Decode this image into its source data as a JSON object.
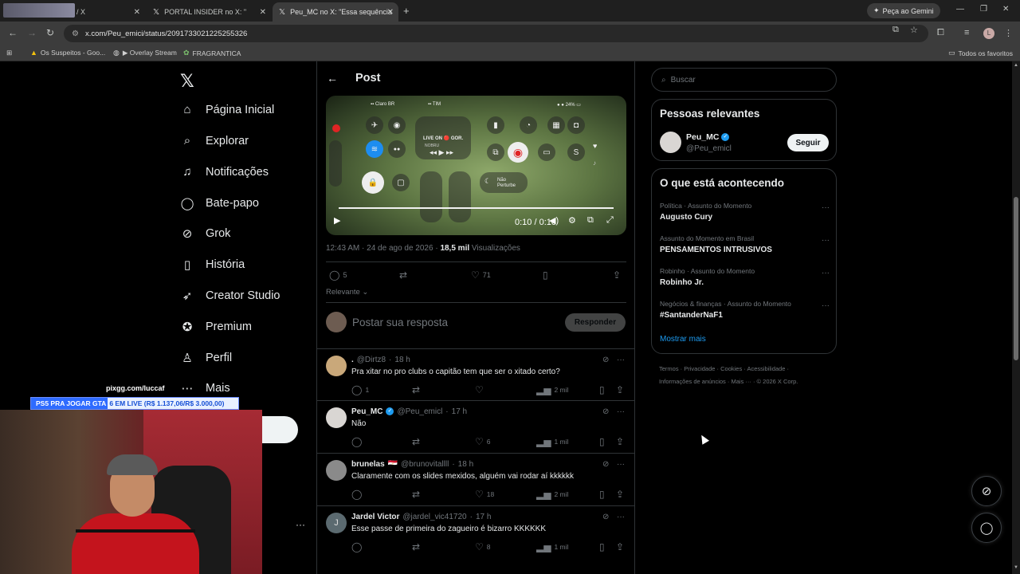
{
  "browser": {
    "tabs": [
      {
        "label": "/ X",
        "icon": "x-logo-icon"
      },
      {
        "label": "PORTAL INSIDER no X: \"",
        "icon": "x-logo-icon",
        "suffix": "Cor"
      },
      {
        "label": "Peu_MC no X: \"Essa sequência",
        "icon": "x-logo-icon",
        "active": true
      }
    ],
    "gemini_label": "Peça ao Gemini",
    "url": "x.com/Peu_emici/status/2091733021225255326",
    "bookmarks": [
      "Os Suspeitos - Goo...",
      "▶ Overlay Stream",
      "FRAGRANTICA"
    ],
    "favorites_label": "Todos os favoritos",
    "profile_initial": "L"
  },
  "nav": {
    "items": [
      {
        "label": "Página Inicial",
        "icon": "home-icon"
      },
      {
        "label": "Explorar",
        "icon": "search-icon"
      },
      {
        "label": "Notificações",
        "icon": "bell-icon"
      },
      {
        "label": "Bate-papo",
        "icon": "chat-icon"
      },
      {
        "label": "Grok",
        "icon": "grok-icon"
      },
      {
        "label": "História",
        "icon": "bookmark-icon"
      },
      {
        "label": "Creator Studio",
        "icon": "rocket-icon"
      },
      {
        "label": "Premium",
        "icon": "verified-badge-icon"
      },
      {
        "label": "Perfil",
        "icon": "person-icon"
      },
      {
        "label": "Mais",
        "icon": "more-circle-icon"
      }
    ]
  },
  "stream": {
    "url": "pixgg.com/luccaf",
    "banner_left": "PS5 PRA JOGAR GTA",
    "banner_right": "6 EM LIVE (R$ 1.137,06/R$ 3.000,00)"
  },
  "post": {
    "header_title": "Post",
    "video": {
      "status_left": "Claro BR",
      "status_mid": "TIM",
      "status_right": "24%",
      "live_label": "LIVE ON",
      "live_sub": "GOR.",
      "nobru": "NOBRU",
      "dnd_label": "Não Perturbe",
      "time": "0:10 / 0:10",
      "progress": 1.0
    },
    "timestamp": "12:43 AM · 24 de ago de 2026 · ",
    "views_count": "18,5 mil",
    "views_label": "Visualizações",
    "replies": "5",
    "likes": "71",
    "sort_label": "Relevante",
    "reply_placeholder": "Postar sua resposta",
    "reply_button": "Responder"
  },
  "replies": [
    {
      "name": ".",
      "handle": "@Dirtz8",
      "time": "18 h",
      "text": "Pra xitar no pro clubs o capitão tem que ser o xitado certo?",
      "replies": "1",
      "retweets": "",
      "likes": "",
      "views": "2 mil",
      "avatar_color": "#c9a87a",
      "verified": false,
      "flag": ""
    },
    {
      "name": "Peu_MC",
      "handle": "@Peu_emicl",
      "time": "17 h",
      "text": "Não",
      "replies": "",
      "retweets": "",
      "likes": "6",
      "views": "1 mil",
      "avatar_color": "#d9d6d3",
      "verified": true,
      "flag": ""
    },
    {
      "name": "brunelas",
      "handle": "@brunovitallll",
      "time": "18 h",
      "text": "Claramente com os slides mexidos, alguém vai rodar aí kkkkkk",
      "replies": "",
      "retweets": "",
      "likes": "18",
      "views": "2 mil",
      "avatar_color": "#8a8a8a",
      "verified": false,
      "flag": "🇪🇬"
    },
    {
      "name": "Jardel Victor",
      "handle": "@jardel_vic41720",
      "time": "17 h",
      "text": "Esse passe de primeira do zagueiro é bizarro KKKKKK",
      "replies": "",
      "retweets": "",
      "likes": "8",
      "views": "1 mil",
      "avatar_color": "#5b6a70",
      "verified": false,
      "flag": "",
      "initial": "J"
    }
  ],
  "sidebar": {
    "search_placeholder": "Buscar",
    "relevant_title": "Pessoas relevantes",
    "person_name": "Peu_MC",
    "person_handle": "@Peu_emicl",
    "follow_label": "Seguir",
    "trending_title": "O que está acontecendo",
    "trends": [
      {
        "category": "Política · Assunto do Momento",
        "title": "Augusto Cury"
      },
      {
        "category": "Assunto do Momento em Brasil",
        "title": "PENSAMENTOS INTRUSIVOS"
      },
      {
        "category": "Robinho · Assunto do Momento",
        "title": "Robinho Jr."
      },
      {
        "category": "Negócios & finanças · Assunto do Momento",
        "title": "#SantanderNaF1"
      }
    ],
    "show_more": "Mostrar mais",
    "footer_line1": "Termos  ·  Privacidade  ·  Cookies  ·  Acessibilidade  ·",
    "footer_line2": "Informações de anúncios  ·  Mais ···  ·  © 2026 X Corp."
  }
}
